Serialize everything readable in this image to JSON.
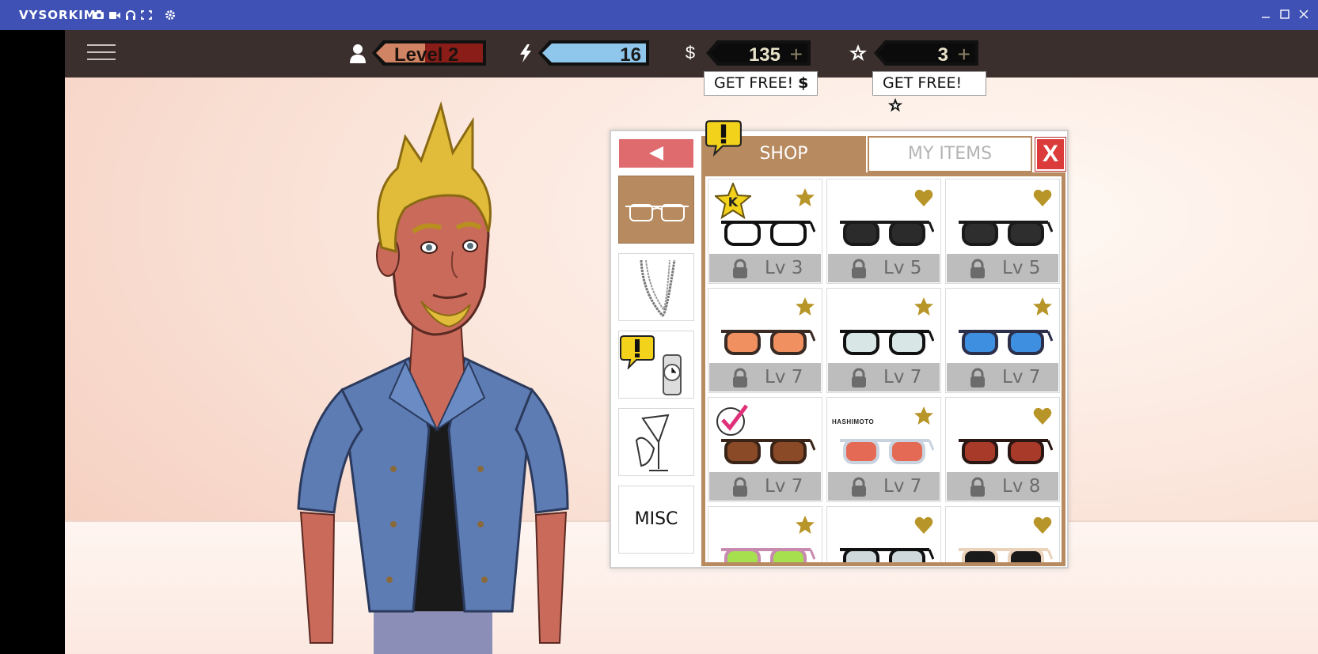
{
  "window": {
    "title": "VYSORKIM",
    "tools": [
      "camera-icon",
      "video-icon",
      "headset-icon",
      "fullscreen-icon",
      "settings-icon"
    ],
    "controls": [
      "minimize-icon",
      "maximize-icon",
      "close-icon"
    ]
  },
  "hud": {
    "level_label": "Level 2",
    "level_progress": 0.46,
    "energy": "16",
    "money": "135",
    "stars": "3",
    "get_free_money": "GET FREE!",
    "get_free_stars": "GET FREE!",
    "money_symbol": "$"
  },
  "shop": {
    "tab_shop": "SHOP",
    "tab_my_items": "MY ITEMS",
    "close_label": "X",
    "categories": [
      {
        "name": "glasses",
        "icon": "glasses-icon",
        "active": true
      },
      {
        "name": "necklaces",
        "icon": "necklace-icon",
        "active": false
      },
      {
        "name": "watches",
        "icon": "watch-icon",
        "active": false,
        "alert": true
      },
      {
        "name": "drinks",
        "icon": "cocktail-glass-icon",
        "active": false
      },
      {
        "name": "misc",
        "label": "MISC",
        "active": false
      }
    ],
    "items": [
      {
        "level": "Lv 3",
        "badge": "star",
        "frame": "#111111",
        "lens": "#ffffff",
        "k_star": true
      },
      {
        "level": "Lv 5",
        "badge": "heart",
        "frame": "#1a1a1a",
        "lens": "#2b2b2b"
      },
      {
        "level": "Lv 5",
        "badge": "heart",
        "frame": "#1a1a1a",
        "lens": "#2e2e2e"
      },
      {
        "level": "Lv 7",
        "badge": "star",
        "frame": "#3a2a24",
        "lens": "#f09060"
      },
      {
        "level": "Lv 7",
        "badge": "star",
        "frame": "#111111",
        "lens": "#d9e6e6"
      },
      {
        "level": "Lv 7",
        "badge": "star",
        "frame": "#2b2f4a",
        "lens": "#3f8fe0"
      },
      {
        "level": "Lv 7",
        "badge": "check",
        "frame": "#3a2418",
        "lens": "#8a4a28"
      },
      {
        "level": "Lv 7",
        "badge": "star",
        "frame": "#c9d3df",
        "lens": "#e46a55",
        "brand": "HASHIMOTO"
      },
      {
        "level": "Lv 8",
        "badge": "heart",
        "frame": "#2a1612",
        "lens": "#a83a2a"
      },
      {
        "level": "",
        "badge": "star",
        "frame": "#c98ab0",
        "lens": "#a6e04e"
      },
      {
        "level": "",
        "badge": "heart",
        "frame": "#111111",
        "lens": "#cfd9dc"
      },
      {
        "level": "",
        "badge": "heart",
        "frame": "#ead2bb",
        "lens": "#1a1a1a"
      }
    ]
  },
  "colors": {
    "titlebar": "#3f51b5",
    "accent": "#b78a5f",
    "close": "#dc3b3b",
    "back": "#e06b6f",
    "gold": "#b89528"
  }
}
